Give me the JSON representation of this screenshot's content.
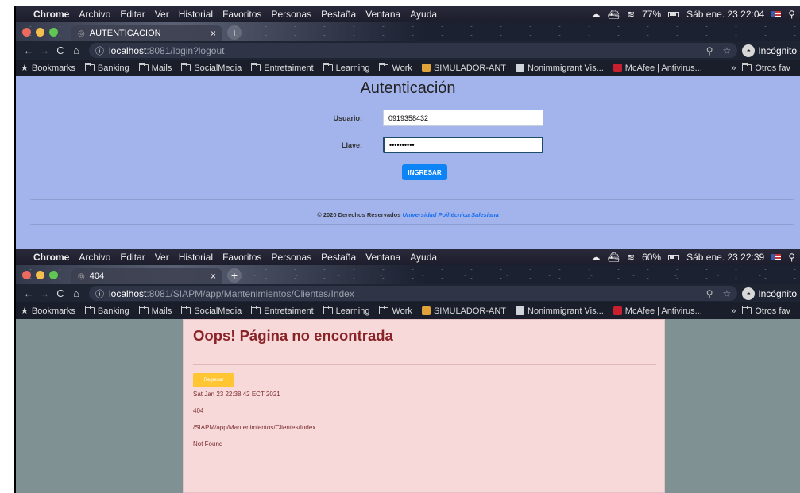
{
  "menubar": {
    "app": "Chrome",
    "items": [
      "Archivo",
      "Editar",
      "Ver",
      "Historial",
      "Favoritos",
      "Personas",
      "Pestaña",
      "Ventana",
      "Ayuda"
    ]
  },
  "top": {
    "menubar": {
      "battery": "77%",
      "clock": "Sáb ene. 23  22:04",
      "battery_level": 0.77
    },
    "tab_title": "AUTENTICACION",
    "url_host": "localhost",
    "url_path": ":8081/login?logout",
    "page": {
      "title": "Autenticación",
      "user_label": "Usuario:",
      "user_value": "0919358432",
      "pass_label": "Llave:",
      "pass_value": "••••••••••",
      "submit": "INGRESAR",
      "footer_text": "© 2020 Derechos Reservados",
      "footer_link": "Universidad Poiltécnica Salesiana"
    }
  },
  "bottom": {
    "menubar": {
      "battery": "60%",
      "clock": "Sáb ene. 23  22:39",
      "battery_level": 0.6
    },
    "tab_title": "404",
    "url_host": "localhost",
    "url_path": ":8081/SIAPM/app/Mantenimientos/Clientes/Index",
    "page": {
      "title": "Oops! Página no encontrada",
      "back_button": "Regresar",
      "timestamp": "Sat Jan 23 22:38:42 ECT 2021",
      "status": "404",
      "path": "/SIAPM/app/Mantenimientos/Clientes/Index",
      "error": "Not Found"
    }
  },
  "browser": {
    "incognito_label": "Incógnito",
    "bookmarks": [
      "Bookmarks",
      "Banking",
      "Mails",
      "SocialMedia",
      "Entretaiment",
      "Learning",
      "Work",
      "SIMULADOR-ANT",
      "Nonimmigrant Vis...",
      "McAfee | Antivirus..."
    ],
    "bookmarks_more": "»",
    "other_bookmarks": "Otros fav"
  },
  "colors": {
    "login_bg": "#a3b4ec",
    "primary_button": "#0d84f5",
    "error_card": "#f8d9da",
    "error_title": "#8a2328",
    "warning_button": "#ffc533"
  }
}
